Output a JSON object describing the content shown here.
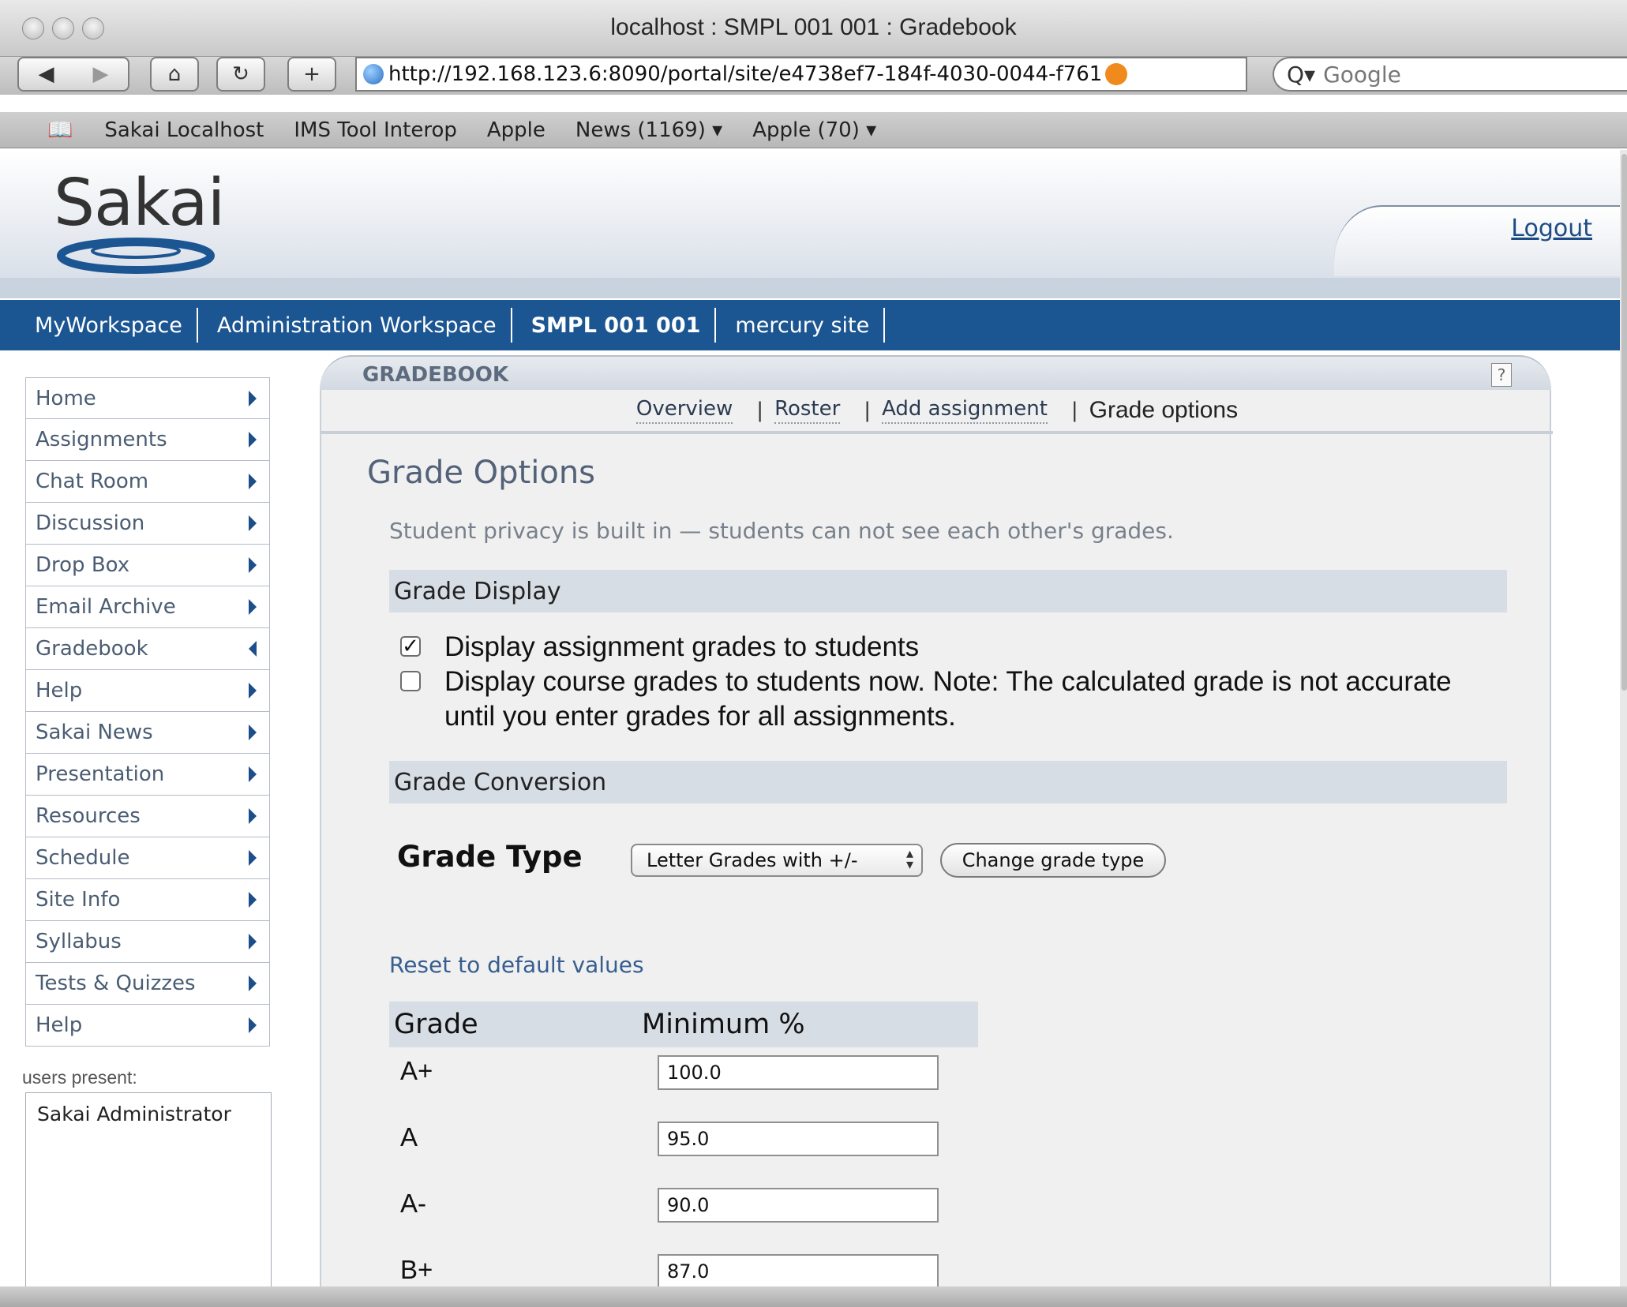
{
  "window": {
    "title": "localhost : SMPL 001 001 : Gradebook"
  },
  "browser": {
    "url": "http://192.168.123.6:8090/portal/site/e4738ef7-184f-4030-0044-f761",
    "search_placeholder": "Google",
    "bookmarks": [
      "Sakai Localhost",
      "IMS Tool Interop",
      "Apple",
      "News (1169) ▾",
      "Apple (70) ▾"
    ]
  },
  "header": {
    "logo_text": "Sakai",
    "logout": "Logout"
  },
  "site_tabs": [
    {
      "label": "MyWorkspace"
    },
    {
      "label": "Administration Workspace"
    },
    {
      "label": "SMPL 001 001"
    },
    {
      "label": "mercury site"
    }
  ],
  "tool_menu": [
    {
      "label": "Home"
    },
    {
      "label": "Assignments"
    },
    {
      "label": "Chat Room"
    },
    {
      "label": "Discussion"
    },
    {
      "label": "Drop Box"
    },
    {
      "label": "Email Archive"
    },
    {
      "label": "Gradebook"
    },
    {
      "label": "Help"
    },
    {
      "label": "Sakai News"
    },
    {
      "label": "Presentation"
    },
    {
      "label": "Resources"
    },
    {
      "label": "Schedule"
    },
    {
      "label": "Site Info"
    },
    {
      "label": "Syllabus"
    },
    {
      "label": "Tests & Quizzes"
    },
    {
      "label": "Help"
    }
  ],
  "presence": {
    "label": "users present:",
    "users": [
      "Sakai Administrator"
    ]
  },
  "tool": {
    "title": "GRADEBOOK",
    "help": "?",
    "nav": {
      "overview": "Overview",
      "roster": "Roster",
      "add_assignment": "Add assignment",
      "grade_options": "Grade options",
      "separator": "|"
    },
    "page_title": "Grade Options",
    "privacy_note": "Student privacy is built in — students can not see each other's grades.",
    "grade_display": {
      "heading": "Grade Display",
      "opt_assignment": "Display assignment grades to students",
      "opt_assignment_checked": true,
      "opt_course": "Display course grades to students now. Note: The calculated grade is not accurate until you enter grades for all assignments.",
      "opt_course_checked": false
    },
    "grade_conversion": {
      "heading": "Grade Conversion",
      "grade_type_label": "Grade Type",
      "grade_type_value": "Letter Grades with +/-",
      "change_button": "Change grade type",
      "reset_link": "Reset to default values",
      "col_grade": "Grade",
      "col_min": "Minimum %",
      "rows": [
        {
          "grade": "A+",
          "min": "100.0"
        },
        {
          "grade": "A",
          "min": "95.0"
        },
        {
          "grade": "A-",
          "min": "90.0"
        },
        {
          "grade": "B+",
          "min": "87.0"
        }
      ]
    }
  }
}
